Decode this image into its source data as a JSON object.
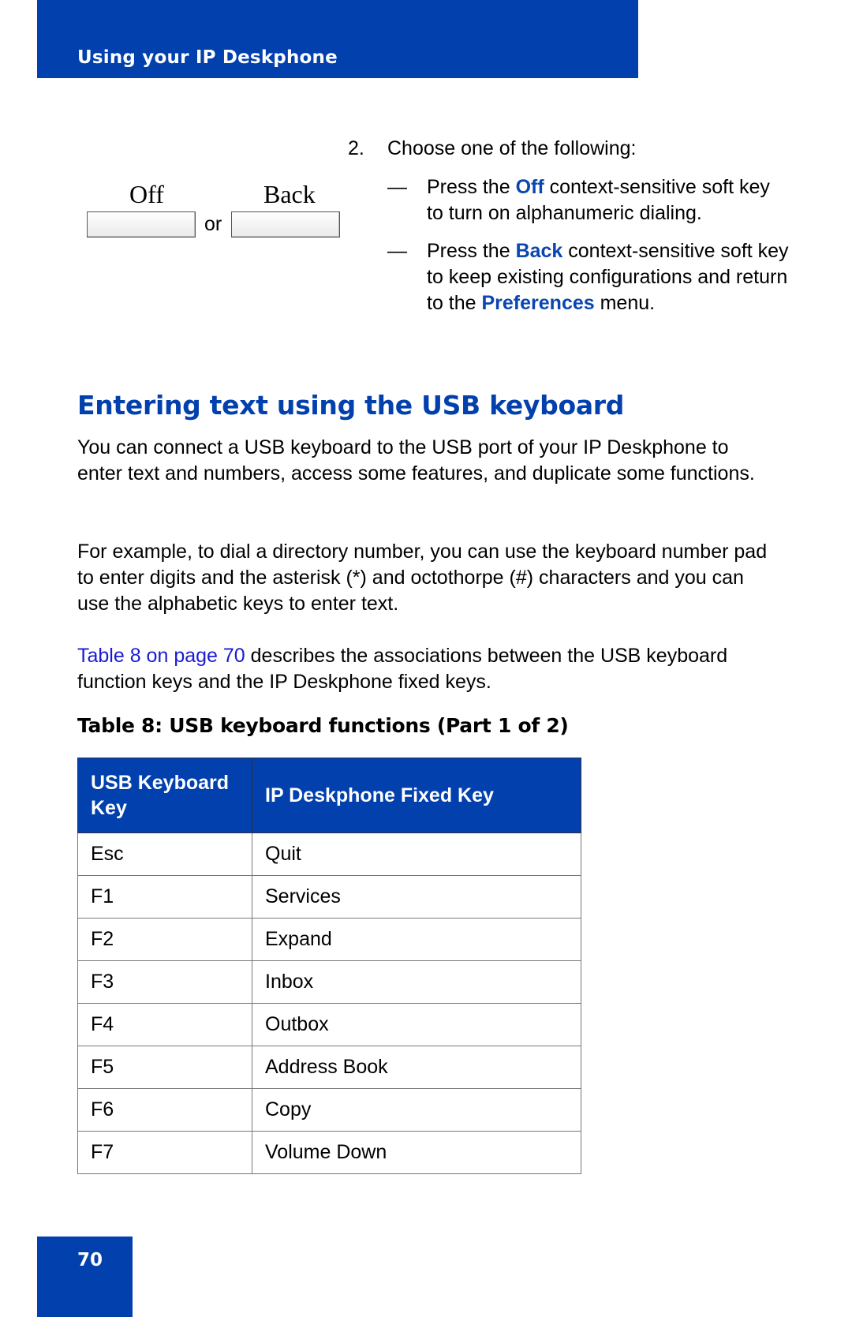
{
  "header": {
    "title": "Using your IP Deskphone"
  },
  "softkeys": {
    "off_label": "Off",
    "back_label": "Back",
    "or_text": "or"
  },
  "step": {
    "number": "2.",
    "text": "Choose one of the following:",
    "options": [
      {
        "dash": "—",
        "prefix": "Press the ",
        "key": "Off",
        "suffix": " context-sensitive soft key to turn on alphanumeric dialing."
      },
      {
        "dash": "—",
        "prefix": "Press the ",
        "key": "Back",
        "suffix": " context-sensitive soft key to keep existing configurations and return to the ",
        "menu": "Preferences",
        "end": " menu."
      }
    ]
  },
  "section": {
    "title": "Entering text using the USB keyboard",
    "para1": "You can connect a USB keyboard to the USB port of your IP Deskphone to enter text and numbers, access some features, and duplicate some functions.",
    "para2": "For example, to dial a directory number, you can use the keyboard number pad to enter digits and the asterisk (*) and octothorpe (#) characters and you can use the alphabetic keys to enter text.",
    "para3_link": "Table 8 on page 70",
    "para3_rest": " describes the associations between the USB keyboard function keys and the IP Deskphone fixed keys."
  },
  "table": {
    "caption": "Table 8: USB keyboard functions (Part 1 of 2)",
    "headers": [
      "USB Keyboard Key",
      "IP Deskphone Fixed Key"
    ],
    "rows": [
      [
        "Esc",
        "Quit"
      ],
      [
        "F1",
        "Services"
      ],
      [
        "F2",
        "Expand"
      ],
      [
        "F3",
        "Inbox"
      ],
      [
        "F4",
        "Outbox"
      ],
      [
        "F5",
        "Address Book"
      ],
      [
        "F6",
        "Copy"
      ],
      [
        "F7",
        "Volume Down"
      ]
    ]
  },
  "footer": {
    "page_number": "70"
  },
  "colors": {
    "brand_blue": "#0140ad",
    "link_blue": "#1a1ad6",
    "highlight_blue": "#0a46b0"
  }
}
